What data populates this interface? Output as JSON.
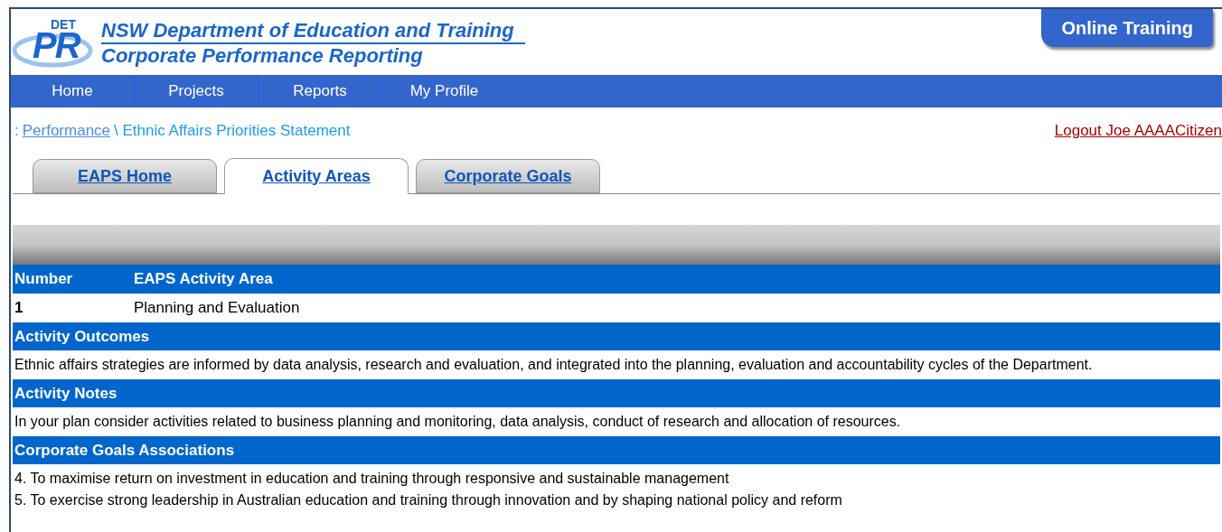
{
  "header": {
    "logo_small": "DET",
    "logo_big": "PR",
    "title": "NSW Department of Education and Training",
    "subtitle": "Corporate Performance Reporting",
    "badge": "Online Training"
  },
  "nav": [
    "Home",
    "Projects",
    "Reports",
    "My Profile"
  ],
  "breadcrumb": {
    "prefix": ":",
    "link": "Performance",
    "separator": "\\",
    "current": "Ethnic Affairs Priorities Statement"
  },
  "logout": "Logout Joe AAAACitizen",
  "tabs": [
    {
      "label": "EAPS Home",
      "selected": false
    },
    {
      "label": "Activity Areas",
      "selected": true
    },
    {
      "label": "Corporate Goals",
      "selected": false
    }
  ],
  "table": {
    "columns": [
      "Number",
      "EAPS Activity Area"
    ],
    "rows": [
      [
        "1",
        "Planning and Evaluation"
      ]
    ]
  },
  "sections": [
    {
      "heading": "Activity Outcomes",
      "lines": [
        "Ethnic affairs strategies are informed by data analysis, research and evaluation, and integrated into the planning, evaluation and accountability cycles of the Department."
      ]
    },
    {
      "heading": "Activity Notes",
      "lines": [
        "In your plan consider activities related to business planning and monitoring, data analysis, conduct of research and allocation of resources."
      ]
    },
    {
      "heading": "Corporate Goals Associations",
      "lines": [
        "4. To maximise return on investment in education and training through responsive and sustainable management",
        "5. To exercise strong leadership in Australian education and training through innovation and by shaping national policy and reform"
      ]
    }
  ]
}
